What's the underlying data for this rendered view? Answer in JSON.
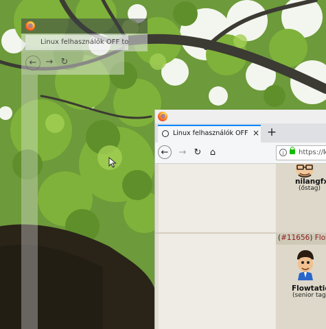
{
  "ghost_window": {
    "tab_title": "Linux felhasználók OFF top",
    "logo_icon": "firefox-icon",
    "back_icon": "arrow-left-icon",
    "forward_icon": "arrow-right-icon",
    "reload_icon": "reload-icon"
  },
  "browser": {
    "tab": {
      "title": "Linux felhasználók OFF top",
      "close": "×"
    },
    "new_tab": "+",
    "nav": {
      "back": "←",
      "forward": "→",
      "reload": "↻",
      "home": "⌂"
    },
    "url": {
      "info": "i",
      "text_prefix": "https://",
      "text_host": "lo"
    },
    "colors": {
      "accent": "#0a84ff",
      "lock": "#12bc00",
      "link": "#8c1a1a"
    }
  },
  "forum": {
    "user1": {
      "name": "nilangfx",
      "rank": "(őstag)"
    },
    "post_header": {
      "open_paren": "(",
      "post_id": "#11656",
      "close_paren": ")",
      "user": "Flowta"
    },
    "user2": {
      "name": "Flowtation",
      "rank": "(senior tag)"
    }
  }
}
